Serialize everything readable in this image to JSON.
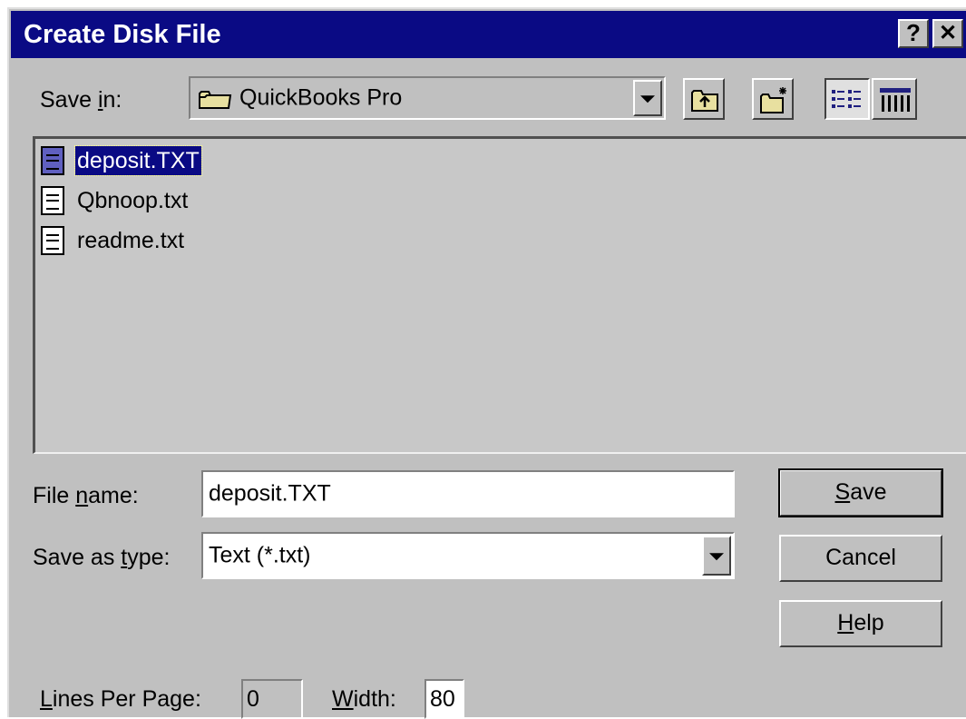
{
  "window": {
    "title": "Create Disk File",
    "help_button": "?",
    "close_button": "✕"
  },
  "save_in": {
    "label_pre": "Save ",
    "label_accel": "i",
    "label_post": "n:",
    "value": "QuickBooks Pro"
  },
  "files": [
    {
      "name": "deposit.TXT",
      "selected": true
    },
    {
      "name": "Qbnoop.txt",
      "selected": false
    },
    {
      "name": "readme.txt",
      "selected": false
    }
  ],
  "file_name": {
    "label_pre": "File ",
    "label_accel": "n",
    "label_post": "ame:",
    "value": "deposit.TXT"
  },
  "save_as_type": {
    "label_pre": "Save as ",
    "label_accel": "t",
    "label_post": "ype:",
    "value": "Text (*.txt)"
  },
  "buttons": {
    "save_accel": "S",
    "save_rest": "ave",
    "cancel": "Cancel",
    "help_accel": "H",
    "help_rest": "elp"
  },
  "lines_per_page": {
    "label_accel": "L",
    "label_rest": "ines Per Page:",
    "value": "0"
  },
  "width": {
    "label_accel": "W",
    "label_rest": "idth:",
    "value": "80"
  },
  "colors": {
    "titlebar": "#0a0a84",
    "face": "#c0c0c0",
    "selection": "#0a0a84"
  }
}
